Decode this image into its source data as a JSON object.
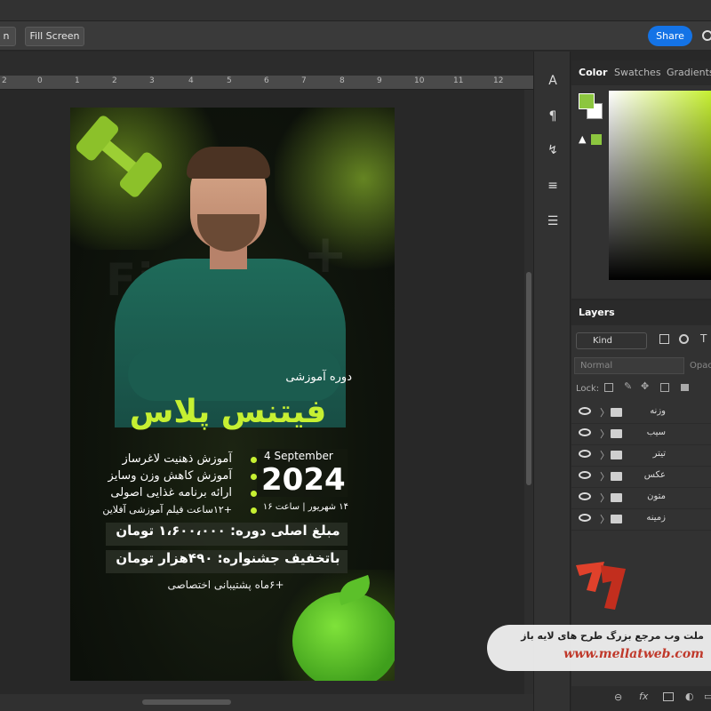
{
  "toolbar": {
    "partial_button": "n",
    "fill_screen": "Fill Screen",
    "share": "Share"
  },
  "ruler": {
    "marks": [
      "2",
      "0",
      "1",
      "2",
      "3",
      "4",
      "5",
      "6",
      "7",
      "8",
      "9",
      "10",
      "11",
      "12"
    ]
  },
  "poster": {
    "bg_word": "Fitness",
    "plus": "+",
    "course_label": "دوره آموزشی",
    "course_title": "فیتنس پلاس",
    "features": [
      "آموزش ذهنیت لاغرساز",
      "آموزش کاهش وزن وسایز",
      "ارائه برنامه غذایی اصولی",
      "+۱۲ساعت فیلم آموزشی آفلاین"
    ],
    "date_en": "4 September",
    "date_year": "2024",
    "date_fa": "۱۴ شهریور | ساعت ۱۶",
    "price_original": "مبلغ اصلی دوره: ۱،۶۰۰،۰۰۰ تومان",
    "price_discount": "باتخفیف جشنواره: ۴۹۰هزار تومان",
    "support": "+۶ماه پشتیبانی اختصاصی"
  },
  "color_panel": {
    "tabs": [
      "Color",
      "Swatches",
      "Gradients"
    ],
    "foreground": "#8cc63f",
    "background": "#ffffff"
  },
  "layers_panel": {
    "title": "Layers",
    "kind": "Kind",
    "blend": "Normal",
    "opacity_label": "Opac",
    "lock_label": "Lock:",
    "layers": [
      "وزنه",
      "سیب",
      "تیتر",
      "عکس",
      "متون",
      "زمینه"
    ]
  },
  "watermark": {
    "tagline": "ملت وب مرجع بزرگ طرح های لایه باز",
    "url": "www.mellatweb.com"
  }
}
